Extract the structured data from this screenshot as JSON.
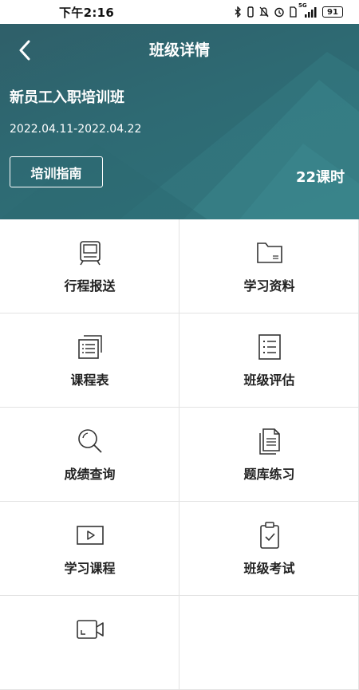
{
  "status_bar": {
    "time": "下午2:16",
    "network": "5G",
    "battery": "91"
  },
  "header": {
    "title": "班级详情",
    "class_name": "新员工入职培训班",
    "date_range": "2022.04.11-2022.04.22",
    "guide_button": "培训指南",
    "hours": "22课时"
  },
  "menu": [
    {
      "label": "行程报送",
      "icon": "train-icon"
    },
    {
      "label": "学习资料",
      "icon": "folder-icon"
    },
    {
      "label": "课程表",
      "icon": "schedule-icon"
    },
    {
      "label": "班级评估",
      "icon": "checklist-icon"
    },
    {
      "label": "成绩查询",
      "icon": "magnifier-icon"
    },
    {
      "label": "题库练习",
      "icon": "document-stack-icon"
    },
    {
      "label": "学习课程",
      "icon": "video-play-icon"
    },
    {
      "label": "班级考试",
      "icon": "clipboard-check-icon"
    },
    {
      "label": "",
      "icon": "video-camera-icon"
    }
  ]
}
